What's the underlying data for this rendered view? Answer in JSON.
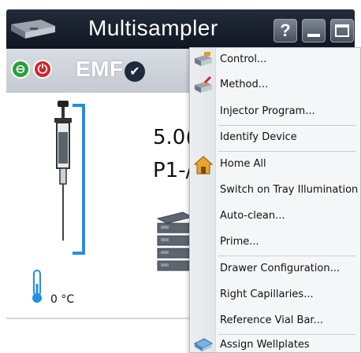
{
  "window": {
    "title": "Multisampler",
    "help_label": "?"
  },
  "status": {
    "emf_label": "EMF",
    "check_mark": "✔"
  },
  "main": {
    "readout_line1": "5.0(",
    "readout_line2": "P1-/",
    "temperature": "0 °C"
  },
  "colors": {
    "accent_blue": "#1e90e6",
    "title_bg": "#161d2b",
    "status_green": "#2e9e3a",
    "status_red": "#d7202a"
  },
  "menu": {
    "items": [
      {
        "label": "Control...",
        "icon": "control-icon"
      },
      {
        "label": "Method...",
        "icon": "method-icon"
      },
      {
        "label": "Injector Program...",
        "icon": ""
      },
      {
        "label": "Identify Device",
        "icon": ""
      },
      {
        "label": "Home All",
        "icon": "home-icon"
      },
      {
        "label": "Switch on Tray Illumination",
        "icon": ""
      },
      {
        "label": "Auto-clean...",
        "icon": ""
      },
      {
        "label": "Prime...",
        "icon": ""
      },
      {
        "label": "Drawer Configuration...",
        "icon": ""
      },
      {
        "label": "Right Capillaries...",
        "icon": ""
      },
      {
        "label": "Reference Vial Bar...",
        "icon": ""
      },
      {
        "label": "Assign Wellplates",
        "icon": "wellplate-icon"
      }
    ]
  }
}
